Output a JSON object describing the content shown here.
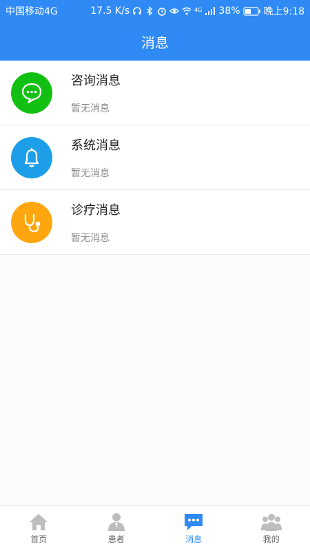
{
  "status_bar": {
    "carrier": "中国移动4G",
    "speed": "17.5 K/s",
    "signal": "4G",
    "battery": "38%",
    "time": "晚上9:18"
  },
  "header": {
    "title": "消息"
  },
  "messages": [
    {
      "title": "咨询消息",
      "subtitle": "暂无消息",
      "icon": "chat-bubble-icon",
      "color": "#12c012"
    },
    {
      "title": "系统消息",
      "subtitle": "暂无消息",
      "icon": "bell-icon",
      "color": "#1d9ee9"
    },
    {
      "title": "诊疗消息",
      "subtitle": "暂无消息",
      "icon": "stethoscope-icon",
      "color": "#ffa60f"
    }
  ],
  "tabs": [
    {
      "label": "首页",
      "icon": "home-icon",
      "active": false
    },
    {
      "label": "患者",
      "icon": "patient-icon",
      "active": false
    },
    {
      "label": "消息",
      "icon": "message-icon",
      "active": true
    },
    {
      "label": "我的",
      "icon": "profile-icon",
      "active": false
    }
  ],
  "colors": {
    "primary": "#2f8af5",
    "tab_inactive": "#bdbdbd"
  }
}
